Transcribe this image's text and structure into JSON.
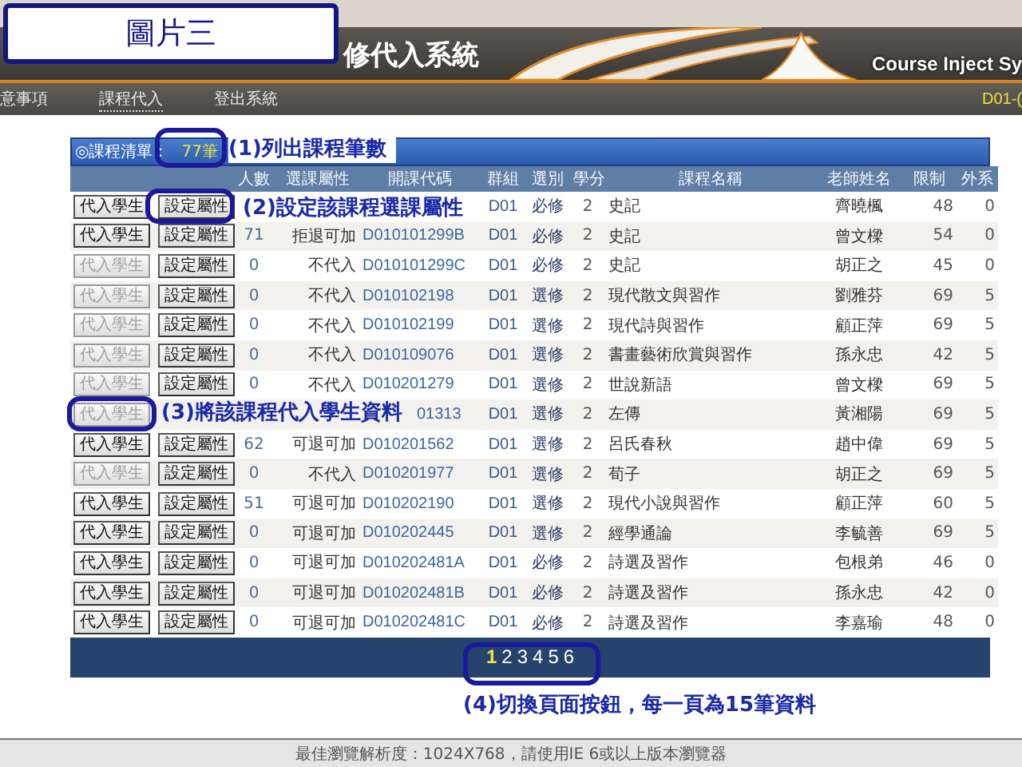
{
  "overlay_label": "圖片三",
  "header": {
    "title": "修代入系統",
    "english_title": "Course Inject Sy"
  },
  "nav": {
    "items": [
      {
        "label": "意事項",
        "selected": false
      },
      {
        "label": "課程代入",
        "selected": true
      },
      {
        "label": "登出系統",
        "selected": false
      }
    ],
    "user": "D01-("
  },
  "list": {
    "title": "◎課程清單：",
    "count": "77筆"
  },
  "annotations": [
    "(1)列出課程筆數",
    "(2)設定該課程選課屬性",
    "(3)將該課程代入學生資料",
    "(4)切換頁面按鈕，每一頁為15筆資料"
  ],
  "table": {
    "columns": [
      "人數",
      "選課屬性",
      "開課代碼",
      "群組",
      "選別",
      "學分",
      "課程名稱",
      "老師姓名",
      "限制",
      "外系"
    ],
    "rows": [
      {
        "inject": "代入學生",
        "inject_disabled": false,
        "setup": "設定屬性",
        "group": "D01",
        "type": "必修",
        "credits": "2",
        "course": "史記",
        "teacher": "齊曉楓",
        "limit": "48",
        "external": "0"
      },
      {
        "inject": "代入學生",
        "inject_disabled": false,
        "setup": "設定屬性",
        "count": "71",
        "attribute": "拒退可加",
        "code": "D010101299B",
        "group": "D01",
        "type": "必修",
        "credits": "2",
        "course": "史記",
        "teacher": "曾文樑",
        "limit": "54",
        "external": "0"
      },
      {
        "inject": "代入學生",
        "inject_disabled": true,
        "setup": "設定屬性",
        "count": "0",
        "attribute": "不代入",
        "code": "D010101299C",
        "group": "D01",
        "type": "必修",
        "credits": "2",
        "course": "史記",
        "teacher": "胡正之",
        "limit": "45",
        "external": "0"
      },
      {
        "inject": "代入學生",
        "inject_disabled": true,
        "setup": "設定屬性",
        "count": "0",
        "attribute": "不代入",
        "code": "D010102198",
        "group": "D01",
        "type": "選修",
        "credits": "2",
        "course": "現代散文與習作",
        "teacher": "劉雅芬",
        "limit": "69",
        "external": "5"
      },
      {
        "inject": "代入學生",
        "inject_disabled": true,
        "setup": "設定屬性",
        "count": "0",
        "attribute": "不代入",
        "code": "D010102199",
        "group": "D01",
        "type": "選修",
        "credits": "2",
        "course": "現代詩與習作",
        "teacher": "顧正萍",
        "limit": "69",
        "external": "5"
      },
      {
        "inject": "代入學生",
        "inject_disabled": true,
        "setup": "設定屬性",
        "count": "0",
        "attribute": "不代入",
        "code": "D010109076",
        "group": "D01",
        "type": "選修",
        "credits": "2",
        "course": "書畫藝術欣賞與習作",
        "teacher": "孫永忠",
        "limit": "42",
        "external": "5"
      },
      {
        "inject": "代入學生",
        "inject_disabled": true,
        "setup": "設定屬性",
        "count": "0",
        "attribute": "不代入",
        "code": "D010201279",
        "group": "D01",
        "type": "選修",
        "credits": "2",
        "course": "世說新語",
        "teacher": "曾文樑",
        "limit": "69",
        "external": "5"
      },
      {
        "inject": "代入學生",
        "inject_disabled": true,
        "code_tail": "01313",
        "group": "D01",
        "type": "選修",
        "credits": "2",
        "course": "左傳",
        "teacher": "黃湘陽",
        "limit": "69",
        "external": "5"
      },
      {
        "inject": "代入學生",
        "inject_disabled": false,
        "setup": "設定屬性",
        "count": "62",
        "attribute": "可退可加",
        "code": "D010201562",
        "group": "D01",
        "type": "選修",
        "credits": "2",
        "course": "呂氏春秋",
        "teacher": "趙中偉",
        "limit": "69",
        "external": "5"
      },
      {
        "inject": "代入學生",
        "inject_disabled": true,
        "setup": "設定屬性",
        "count": "0",
        "attribute": "不代入",
        "code": "D010201977",
        "group": "D01",
        "type": "選修",
        "credits": "2",
        "course": "荀子",
        "teacher": "胡正之",
        "limit": "69",
        "external": "5"
      },
      {
        "inject": "代入學生",
        "inject_disabled": false,
        "setup": "設定屬性",
        "count": "51",
        "attribute": "可退可加",
        "code": "D010202190",
        "group": "D01",
        "type": "選修",
        "credits": "2",
        "course": "現代小說與習作",
        "teacher": "顧正萍",
        "limit": "60",
        "external": "5"
      },
      {
        "inject": "代入學生",
        "inject_disabled": false,
        "setup": "設定屬性",
        "count": "0",
        "attribute": "可退可加",
        "code": "D010202445",
        "group": "D01",
        "type": "選修",
        "credits": "2",
        "course": "經學通論",
        "teacher": "李毓善",
        "limit": "69",
        "external": "5"
      },
      {
        "inject": "代入學生",
        "inject_disabled": false,
        "setup": "設定屬性",
        "count": "0",
        "attribute": "可退可加",
        "code": "D010202481A",
        "group": "D01",
        "type": "必修",
        "credits": "2",
        "course": "詩選及習作",
        "teacher": "包根弟",
        "limit": "46",
        "external": "0"
      },
      {
        "inject": "代入學生",
        "inject_disabled": false,
        "setup": "設定屬性",
        "count": "0",
        "attribute": "可退可加",
        "code": "D010202481B",
        "group": "D01",
        "type": "必修",
        "credits": "2",
        "course": "詩選及習作",
        "teacher": "孫永忠",
        "limit": "42",
        "external": "0"
      },
      {
        "inject": "代入學生",
        "inject_disabled": false,
        "setup": "設定屬性",
        "count": "0",
        "attribute": "可退可加",
        "code": "D010202481C",
        "group": "D01",
        "type": "必修",
        "credits": "2",
        "course": "詩選及習作",
        "teacher": "李嘉瑜",
        "limit": "48",
        "external": "0"
      }
    ]
  },
  "pages": [
    {
      "label": "1",
      "selected": true
    },
    {
      "label": "2",
      "selected": false
    },
    {
      "label": "3",
      "selected": false
    },
    {
      "label": "4",
      "selected": false
    },
    {
      "label": "5",
      "selected": false
    },
    {
      "label": "6",
      "selected": false
    }
  ],
  "footer": "最佳瀏覽解析度：1024X768，請使用IE 6或以上版本瀏覽器"
}
